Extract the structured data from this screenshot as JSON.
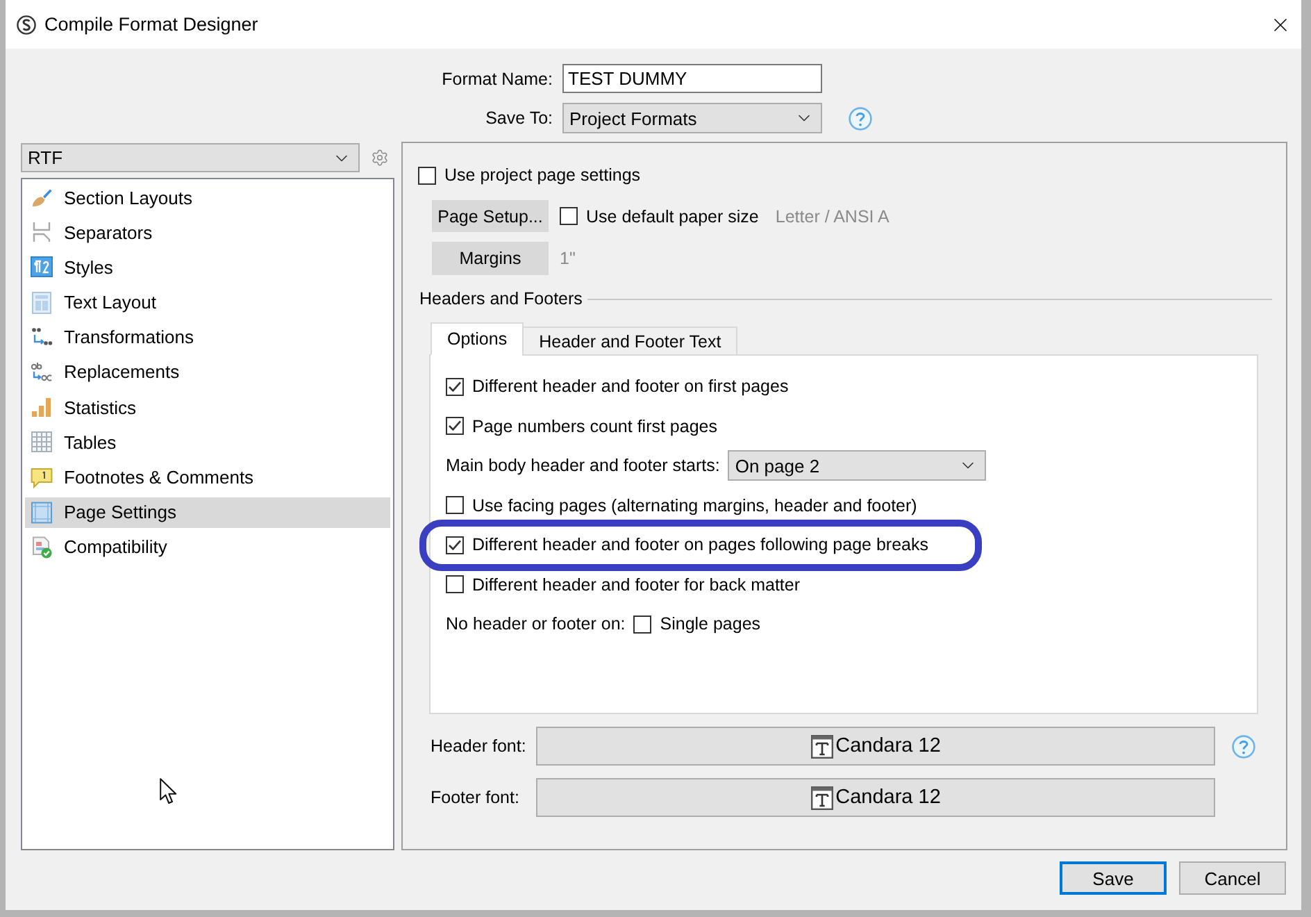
{
  "window": {
    "title": "Compile Format Designer"
  },
  "format_name": {
    "label": "Format Name:",
    "value": "TEST DUMMY"
  },
  "save_to": {
    "label": "Save To:",
    "value": "Project Formats"
  },
  "sidebar": {
    "format": "RTF",
    "items": [
      {
        "label": "Section Layouts",
        "selected": false
      },
      {
        "label": "Separators",
        "selected": false
      },
      {
        "label": "Styles",
        "selected": false
      },
      {
        "label": "Text Layout",
        "selected": false
      },
      {
        "label": "Transformations",
        "selected": false
      },
      {
        "label": "Replacements",
        "selected": false
      },
      {
        "label": "Statistics",
        "selected": false
      },
      {
        "label": "Tables",
        "selected": false
      },
      {
        "label": "Footnotes & Comments",
        "selected": false
      },
      {
        "label": "Page Settings",
        "selected": true
      },
      {
        "label": "Compatibility",
        "selected": false
      }
    ]
  },
  "page_settings": {
    "use_project_settings": {
      "label": "Use project page settings",
      "checked": false
    },
    "page_setup_button": "Page Setup...",
    "default_paper": {
      "label": "Use default paper size",
      "checked": false,
      "value": "Letter / ANSI A"
    },
    "margins_button": "Margins",
    "margins_value": "1\""
  },
  "headers_and_footers": {
    "title": "Headers and Footers",
    "tabs": [
      {
        "label": "Options",
        "selected": true
      },
      {
        "label": "Header and Footer Text",
        "selected": false
      }
    ],
    "options": [
      {
        "kind": "checkbox",
        "label": "Different header and footer on first pages",
        "checked": true,
        "highlighted": false
      },
      {
        "kind": "checkbox",
        "label": "Page numbers count first pages",
        "checked": true,
        "highlighted": false
      },
      {
        "kind": "select",
        "label": "Main body header and footer starts:",
        "value": "On page 2"
      },
      {
        "kind": "checkbox",
        "label": "Use facing pages (alternating margins, header and footer)",
        "checked": false,
        "highlighted": false
      },
      {
        "kind": "checkbox",
        "label": "Different header and footer on pages following page breaks",
        "checked": true,
        "highlighted": true
      },
      {
        "kind": "checkbox",
        "label": "Different header and footer for back matter",
        "checked": false,
        "highlighted": false
      },
      {
        "kind": "inline_checkbox",
        "label": "No header or footer on:",
        "option": "Single pages",
        "checked": false
      }
    ],
    "header_font": {
      "label": "Header font:",
      "value": "Candara 12"
    },
    "footer_font": {
      "label": "Footer font:",
      "value": "Candara 12"
    }
  },
  "buttons": [
    {
      "label": "Save",
      "focused": true
    },
    {
      "label": "Cancel",
      "focused": false
    }
  ]
}
